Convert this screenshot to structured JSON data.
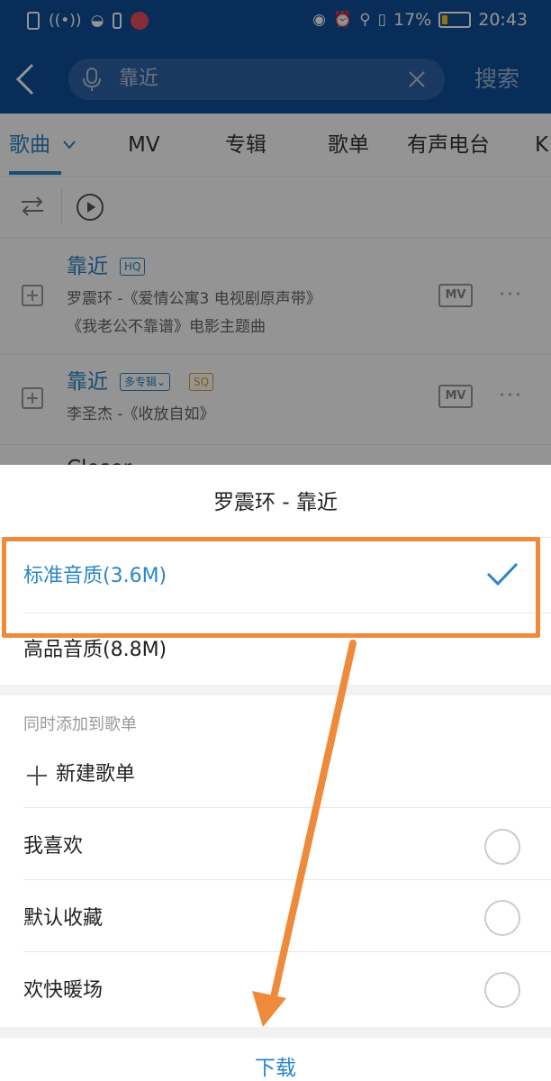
{
  "status_bar": {
    "battery_percent": "17%",
    "time": "20:43"
  },
  "header": {
    "search_query": "靠近",
    "search_button": "搜索"
  },
  "tabs": [
    {
      "label": "歌曲",
      "active": true
    },
    {
      "label": "MV"
    },
    {
      "label": "专辑"
    },
    {
      "label": "歌单"
    },
    {
      "label": "有声电台"
    },
    {
      "label": "K"
    }
  ],
  "songs": [
    {
      "title": "靠近",
      "badges": [
        "HQ"
      ],
      "artist_line": "罗震环 -《爱情公寓3 电视剧原声带》",
      "desc_line": "《我老公不靠谱》电影主题曲",
      "mv_label": "MV"
    },
    {
      "title": "靠近",
      "badges": [
        "多专辑",
        "SQ"
      ],
      "artist_line": "李圣杰 -《收放自如》",
      "mv_label": "MV"
    },
    {
      "title": "Closer"
    }
  ],
  "sheet": {
    "title": "罗震环 - 靠近",
    "quality_options": [
      {
        "label": "标准音质(3.6M)",
        "selected": true
      },
      {
        "label": "高品音质(8.8M)",
        "selected": false
      }
    ],
    "add_to_playlist_label": "同时添加到歌单",
    "new_playlist_label": "新建歌单",
    "playlists": [
      "我喜欢",
      "默认收藏",
      "欢快暖场"
    ],
    "download_label": "下载"
  },
  "colors": {
    "header_blue": "#0f4e9a",
    "accent_blue": "#2a86c9",
    "annotation_orange": "#ef8a3a"
  }
}
